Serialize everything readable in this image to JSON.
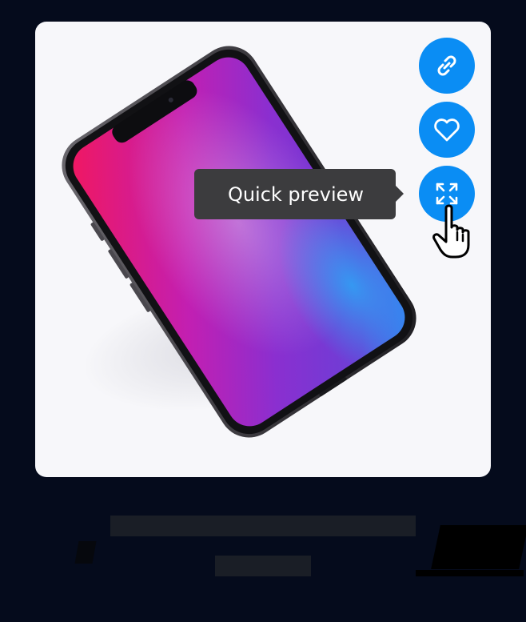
{
  "product_card": {
    "image": {
      "subject": "smartphone-mockup",
      "screen_gradient_colors": [
        "#ef1a6a",
        "#b528c7",
        "#6b3bd8",
        "#3a7cf0"
      ]
    },
    "actions": [
      {
        "name": "link-icon",
        "interactable": true
      },
      {
        "name": "heart-icon",
        "interactable": true
      },
      {
        "name": "expand-icon",
        "interactable": true
      }
    ],
    "tooltip": {
      "text": "Quick preview"
    },
    "cursor": "hand-pointer-icon"
  },
  "colors": {
    "page_background": "#050b1c",
    "card_background": "#f7f7fa",
    "accent": "#0a8df4",
    "tooltip_background": "#3c3c3e",
    "placeholder": "#1a1e26"
  }
}
